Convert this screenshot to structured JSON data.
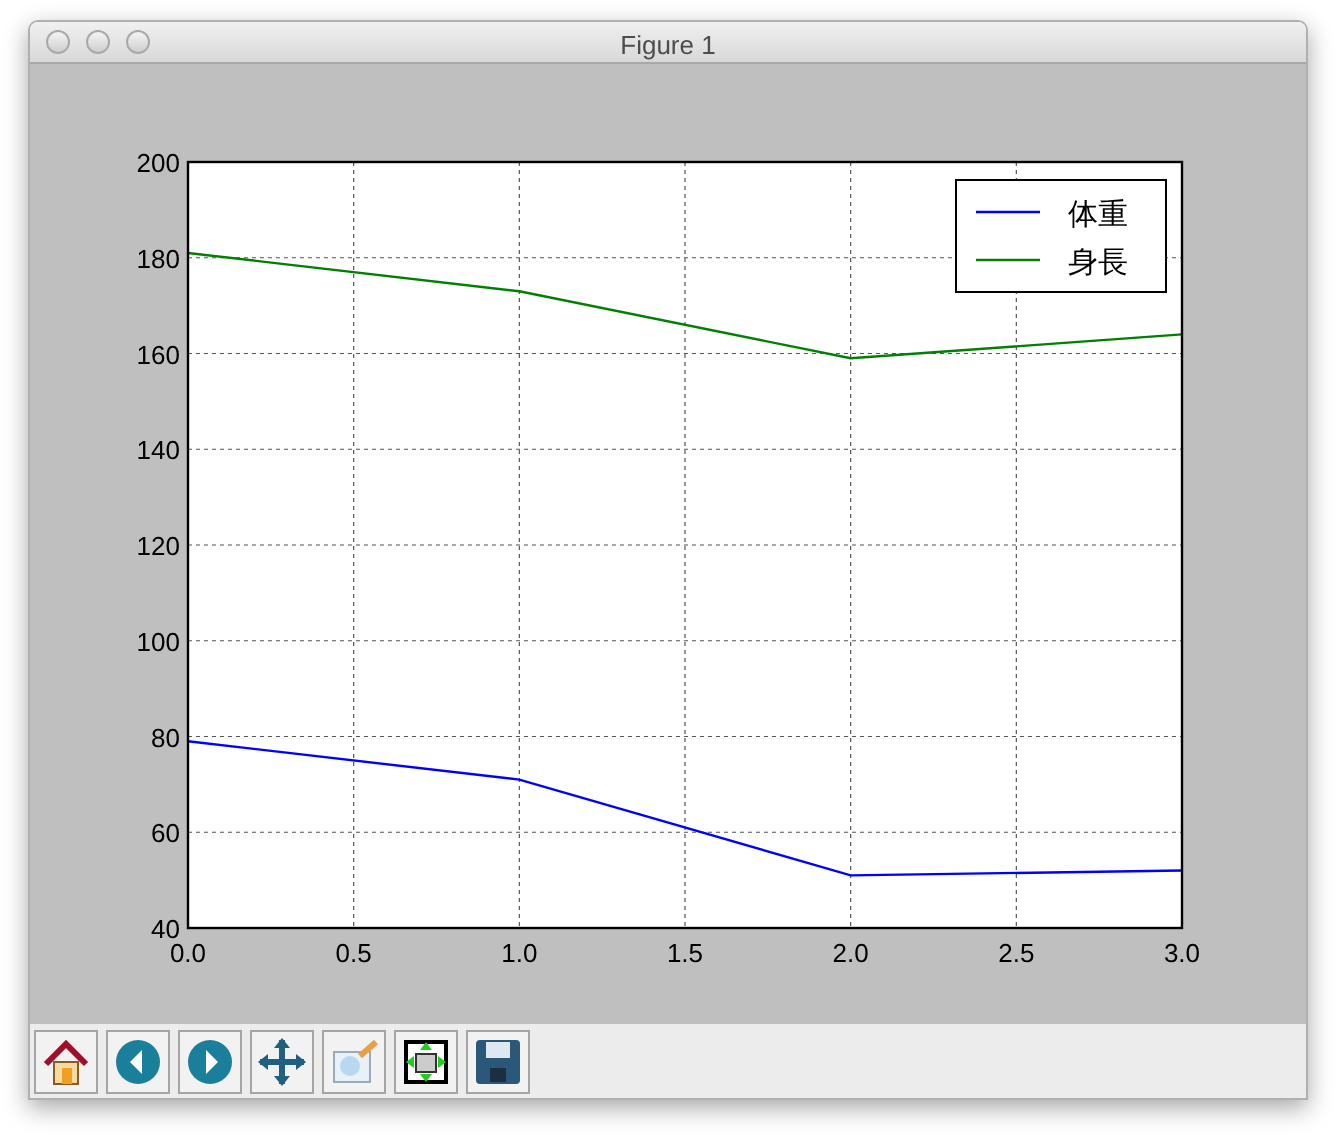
{
  "window": {
    "title": "Figure 1"
  },
  "figure": {
    "chart_data": {
      "type": "line",
      "x": [
        0,
        1,
        2,
        3
      ],
      "series": [
        {
          "name": "体重",
          "color": "#0000ff",
          "values": [
            79,
            71,
            51,
            52
          ]
        },
        {
          "name": "身長",
          "color": "#008000",
          "values": [
            181,
            173,
            159,
            164
          ]
        }
      ],
      "xlim": [
        0,
        3
      ],
      "ylim": [
        40,
        200
      ],
      "xticks": [
        {
          "value": 0,
          "label": "0.0"
        },
        {
          "value": 0.5,
          "label": "0.5"
        },
        {
          "value": 1,
          "label": "1.0"
        },
        {
          "value": 1.5,
          "label": "1.5"
        },
        {
          "value": 2,
          "label": "2.0"
        },
        {
          "value": 2.5,
          "label": "2.5"
        },
        {
          "value": 3,
          "label": "3.0"
        }
      ],
      "yticks": [
        40,
        60,
        80,
        100,
        120,
        140,
        160,
        180,
        200
      ],
      "grid": true,
      "legend": true
    }
  }
}
